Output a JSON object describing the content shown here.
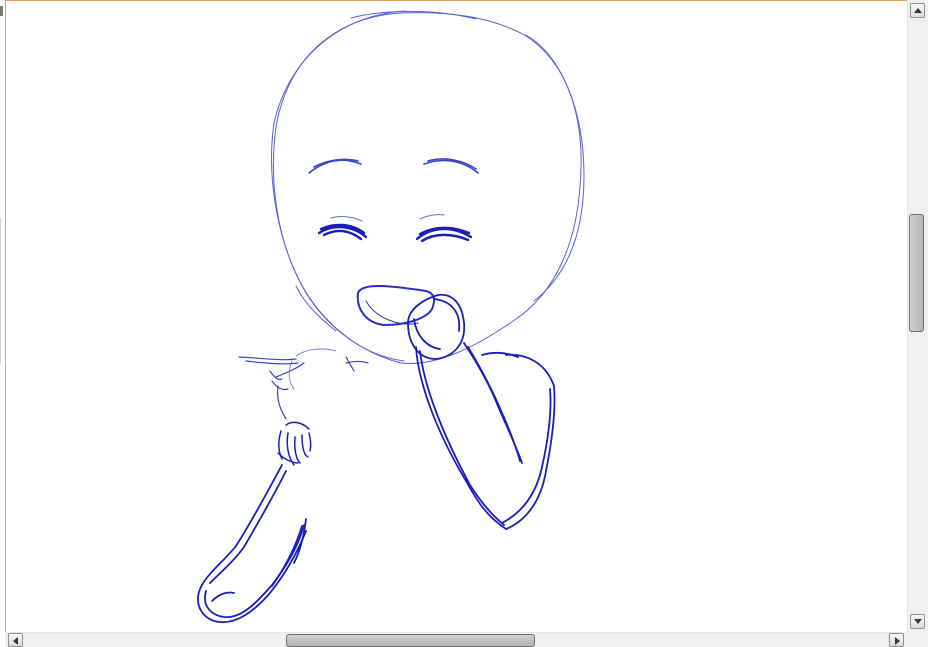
{
  "canvas": {
    "stroke_color": "#1a1fb8",
    "sketch_color_light": "#5a5fd6",
    "background": "#ffffff"
  },
  "scrollbars": {
    "vertical_position": 0.36,
    "horizontal_position": 0.35
  },
  "icons": {
    "scroll_up": "triangle-up-icon",
    "scroll_down": "triangle-down-icon",
    "scroll_left": "triangle-left-icon",
    "scroll_right": "triangle-right-icon"
  }
}
